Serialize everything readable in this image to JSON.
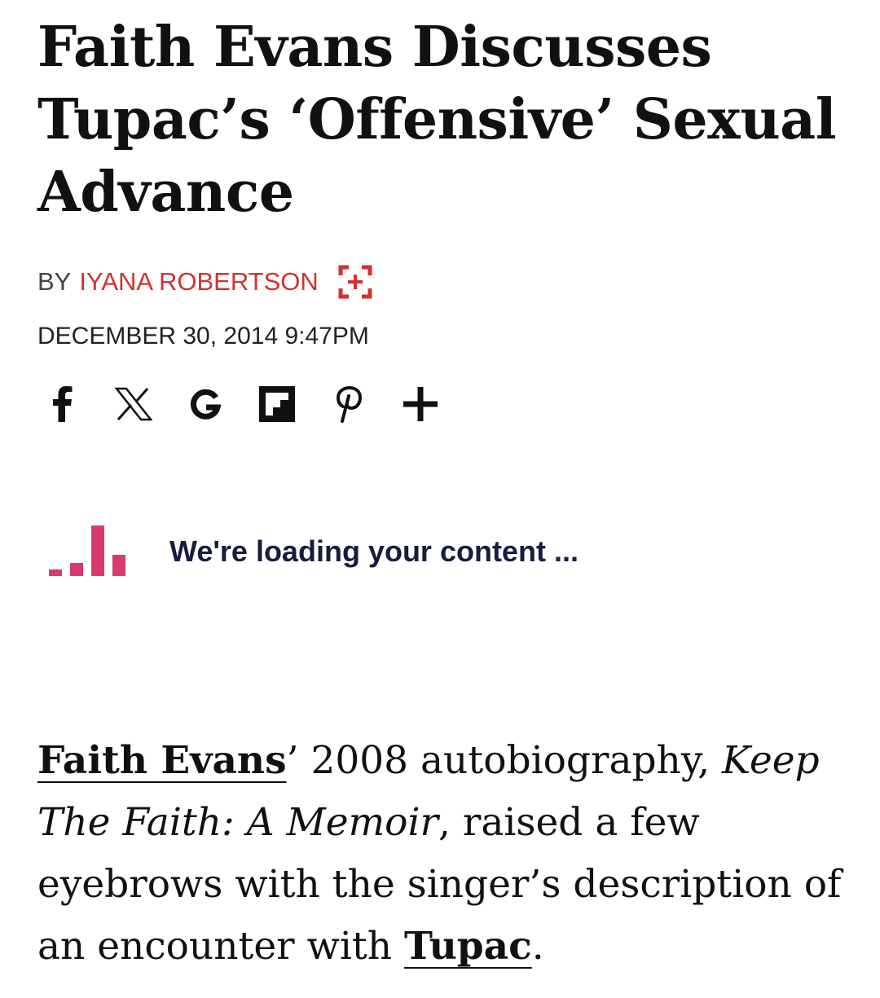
{
  "article": {
    "headline": "Faith Evans Discusses Tupac’s ‘Offensive’ Sexual Advance",
    "by_prefix": "BY",
    "author": "IYANA ROBERTSON",
    "date": "DECEMBER 30, 2014 9:47PM"
  },
  "share": {
    "icons": [
      "facebook-icon",
      "x-icon",
      "google-icon",
      "flipboard-icon",
      "pinterest-icon",
      "plus-icon"
    ]
  },
  "loading": {
    "text": "We're loading your content ...",
    "color": "#d63a6e"
  },
  "body": {
    "link1": "Faith Evans",
    "text1": "’ 2008 autobiography, ",
    "title_italic": "Keep The Faith: A Memoir",
    "text2": ", raised a few eyebrows with the singer’s description of an encounter with ",
    "link2": "Tupac",
    "text3": "."
  },
  "colors": {
    "author": "#d2322d",
    "loader_text": "#171d3d"
  }
}
